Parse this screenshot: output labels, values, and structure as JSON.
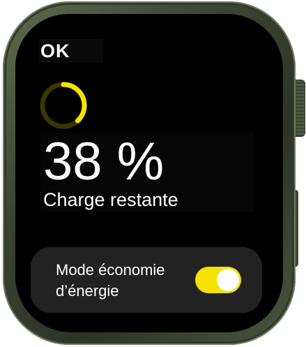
{
  "header": {
    "ok_label": "OK"
  },
  "battery": {
    "level_percent": 38,
    "value_text": "38 %",
    "label": "Charge restante",
    "ring_color": "#F5E200",
    "ring_track_color": "#3a3600"
  },
  "low_power_mode": {
    "label": "Mode économie d’énergie",
    "enabled": true,
    "toggle_on_color": "#F5E200",
    "toggle_off_color": "#3a3a3a"
  }
}
